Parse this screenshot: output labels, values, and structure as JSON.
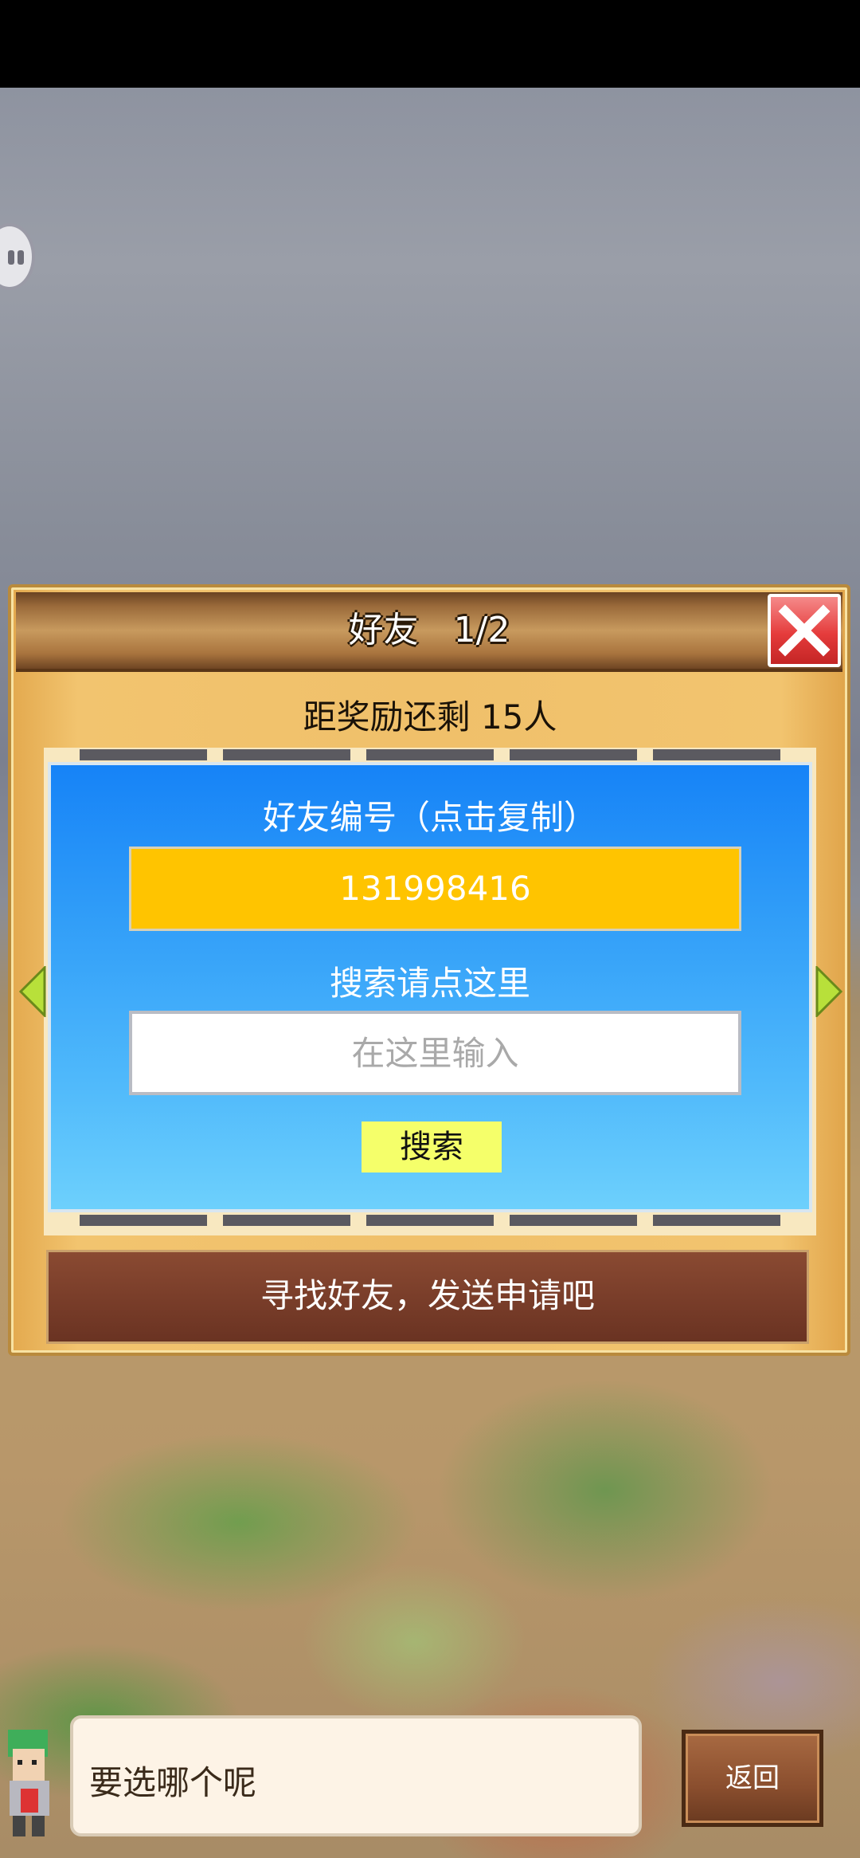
{
  "dialog": {
    "title": "好友　1/2",
    "reward_text": "距奖励还剩 15人"
  },
  "friend_id": {
    "label": "好友编号（点击复制）",
    "value": "131998416"
  },
  "search": {
    "label": "搜索请点这里",
    "placeholder": "在这里输入",
    "button_label": "搜索"
  },
  "find_friends_label": "寻找好友，发送申请吧",
  "bottom": {
    "message": "要选哪个呢",
    "back_label": "返回"
  },
  "icons": {
    "close": "close-icon",
    "pause": "pause-icon",
    "left_arrow": "arrow-left-icon",
    "right_arrow": "arrow-right-icon"
  },
  "colors": {
    "friend_id_box": "#ffc400",
    "search_button": "#f5ff6a",
    "close_button": "#e53c3c",
    "panel_blue": "#2d9af8"
  }
}
